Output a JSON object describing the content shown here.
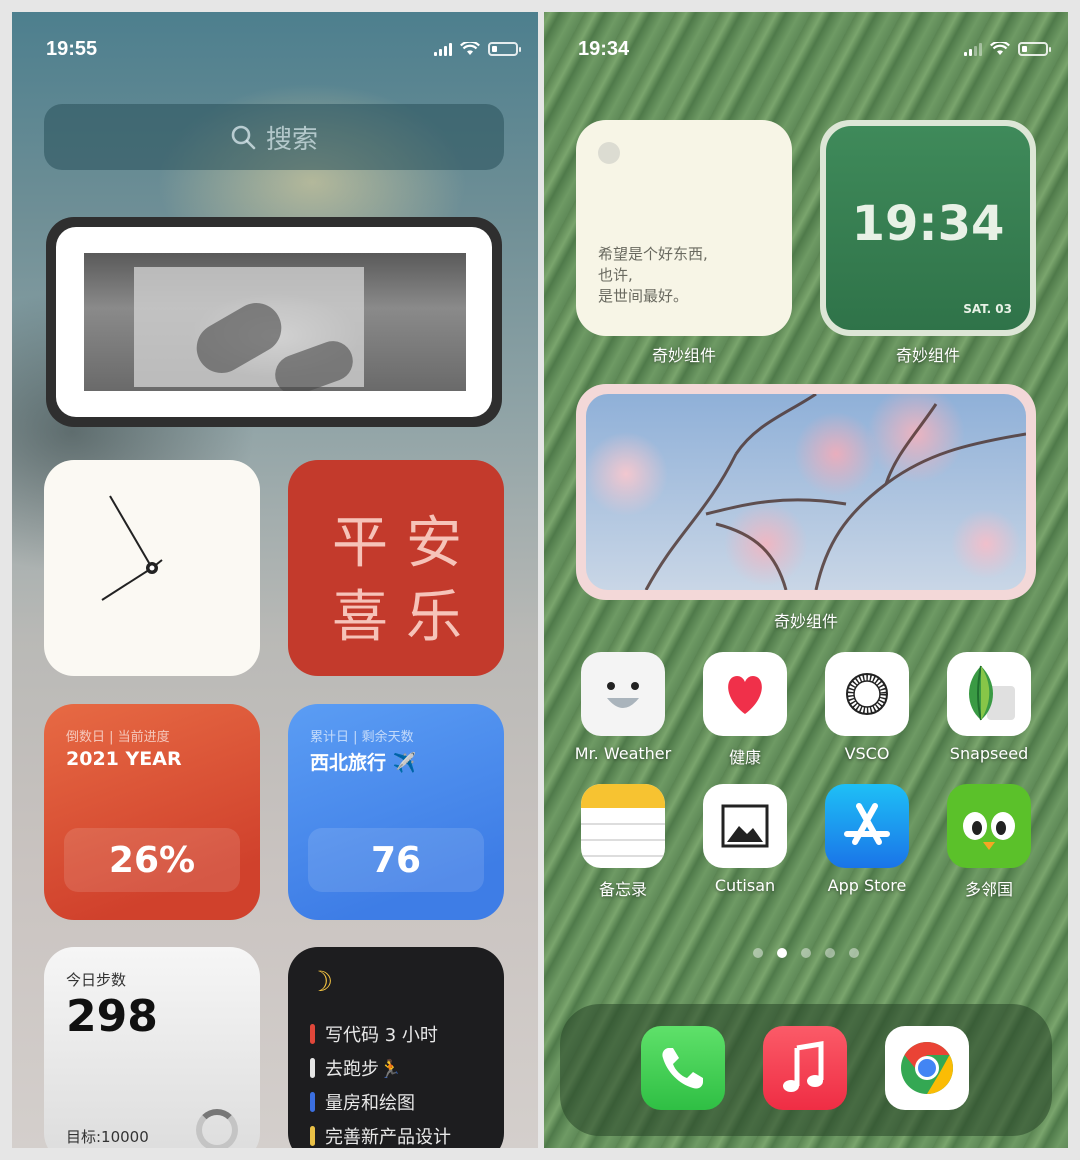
{
  "left": {
    "status": {
      "time": "19:55"
    },
    "search": {
      "placeholder": "搜索"
    },
    "peace_widget": {
      "line1": "平安",
      "line2": "喜乐"
    },
    "countdown_year": {
      "sub": "倒数日 | 当前进度",
      "title": "2021 YEAR",
      "value": "26%"
    },
    "countdown_trip": {
      "sub": "累计日 | 剩余天数",
      "title": "西北旅行 ✈️",
      "value": "76"
    },
    "steps": {
      "label": "今日步数",
      "value": "298",
      "goal": "目标:10000"
    },
    "todo": {
      "icon": "moon-icon",
      "items": [
        {
          "text": "写代码 3 小时",
          "color": "#e0473a"
        },
        {
          "text": "去跑步🏃",
          "color": "#e6e6e6"
        },
        {
          "text": "量房和绘图",
          "color": "#3b6fe0"
        },
        {
          "text": "完善新产品设计",
          "color": "#e9c046"
        }
      ]
    }
  },
  "right": {
    "status": {
      "time": "19:34"
    },
    "quote_widget": {
      "lines": [
        "希望是个好东西,",
        "也许,",
        "是世间最好。"
      ],
      "label": "奇妙组件"
    },
    "clock_widget": {
      "time": "19:34",
      "date": "SAT. 03",
      "label": "奇妙组件"
    },
    "photo_widget": {
      "label": "奇妙组件"
    },
    "apps_row1": [
      {
        "name": "Mr. Weather",
        "icon": "weather-face-icon"
      },
      {
        "name": "健康",
        "icon": "heart-icon"
      },
      {
        "name": "VSCO",
        "icon": "vsco-ring-icon"
      },
      {
        "name": "Snapseed",
        "icon": "snapseed-leaf-icon"
      }
    ],
    "apps_row2": [
      {
        "name": "备忘录",
        "icon": "notes-icon"
      },
      {
        "name": "Cutisan",
        "icon": "mountain-image-icon"
      },
      {
        "name": "App Store",
        "icon": "app-store-icon"
      },
      {
        "name": "多邻国",
        "icon": "duolingo-owl-icon"
      }
    ],
    "page_dots": {
      "count": 5,
      "active": 2
    },
    "dock": [
      {
        "name": "Phone",
        "icon": "phone-icon"
      },
      {
        "name": "Music",
        "icon": "music-icon"
      },
      {
        "name": "Chrome",
        "icon": "chrome-icon"
      }
    ]
  }
}
